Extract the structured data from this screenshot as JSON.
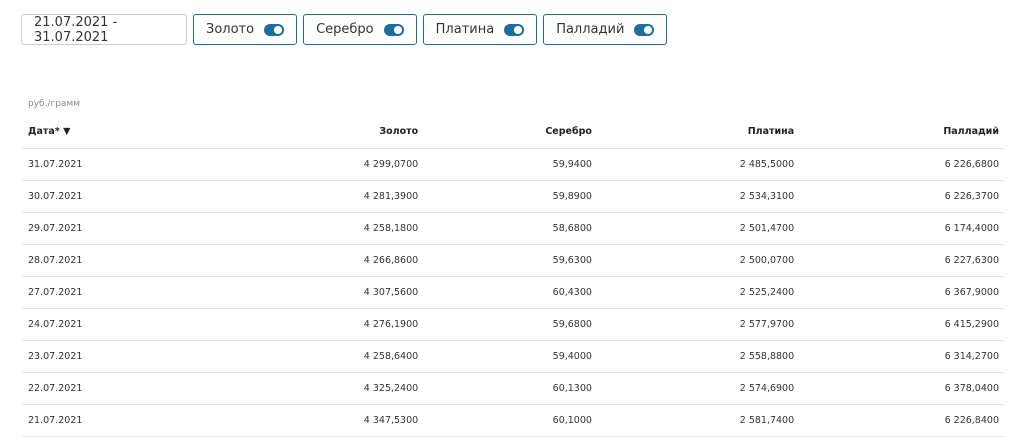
{
  "filters": {
    "date_range": "21.07.2021 - 31.07.2021",
    "metals": [
      {
        "label": "Золото",
        "enabled": true
      },
      {
        "label": "Серебро",
        "enabled": true
      },
      {
        "label": "Платина",
        "enabled": true
      },
      {
        "label": "Палладий",
        "enabled": true
      }
    ]
  },
  "table": {
    "unit": "руб./грамм",
    "headers": {
      "date": "Дата* ▼",
      "gold": "Золото",
      "silver": "Серебро",
      "platinum": "Платина",
      "palladium": "Палладий"
    },
    "rows": [
      [
        "31.07.2021",
        "4 299,0700",
        "59,9400",
        "2 485,5000",
        "6 226,6800"
      ],
      [
        "30.07.2021",
        "4 281,3900",
        "59,8900",
        "2 534,3100",
        "6 226,3700"
      ],
      [
        "29.07.2021",
        "4 258,1800",
        "58,6800",
        "2 501,4700",
        "6 174,4000"
      ],
      [
        "28.07.2021",
        "4 266,8600",
        "59,6300",
        "2 500,0700",
        "6 227,6300"
      ],
      [
        "27.07.2021",
        "4 307,5600",
        "60,4300",
        "2 525,2400",
        "6 367,9000"
      ],
      [
        "24.07.2021",
        "4 276,1900",
        "59,6800",
        "2 577,9700",
        "6 415,2900"
      ],
      [
        "23.07.2021",
        "4 258,6400",
        "59,4000",
        "2 558,8800",
        "6 314,2700"
      ],
      [
        "22.07.2021",
        "4 325,2400",
        "60,1300",
        "2 574,6900",
        "6 378,0400"
      ],
      [
        "21.07.2021",
        "4 347,5300",
        "60,1000",
        "2 581,7400",
        "6 226,8400"
      ]
    ]
  },
  "colors": {
    "accent": "#1b6e9e",
    "border": "#cfcfcf",
    "row_divider": "#e6e6e6"
  }
}
